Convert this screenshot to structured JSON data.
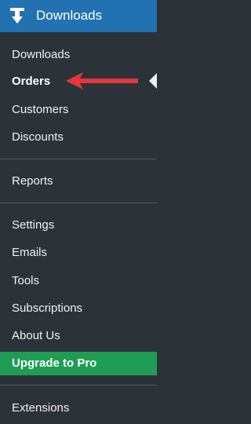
{
  "menu": {
    "title": "Downloads",
    "icon": "download-arrow-icon",
    "colors": {
      "header_bg": "#2271b1",
      "menu_bg": "#2c3338",
      "promo_bg": "#1f9d55",
      "arrow": "#e5363d"
    },
    "items": [
      {
        "label": "Downloads"
      },
      {
        "label": "Orders",
        "current": true
      },
      {
        "label": "Customers"
      },
      {
        "label": "Discounts"
      },
      {
        "label": "Reports"
      },
      {
        "label": "Settings"
      },
      {
        "label": "Emails"
      },
      {
        "label": "Tools"
      },
      {
        "label": "Subscriptions"
      },
      {
        "label": "About Us"
      }
    ],
    "promo": {
      "label": "Upgrade to Pro"
    },
    "extensions": {
      "label": "Extensions"
    }
  },
  "annotation": {
    "icon": "red-pointer-arrow-icon"
  }
}
